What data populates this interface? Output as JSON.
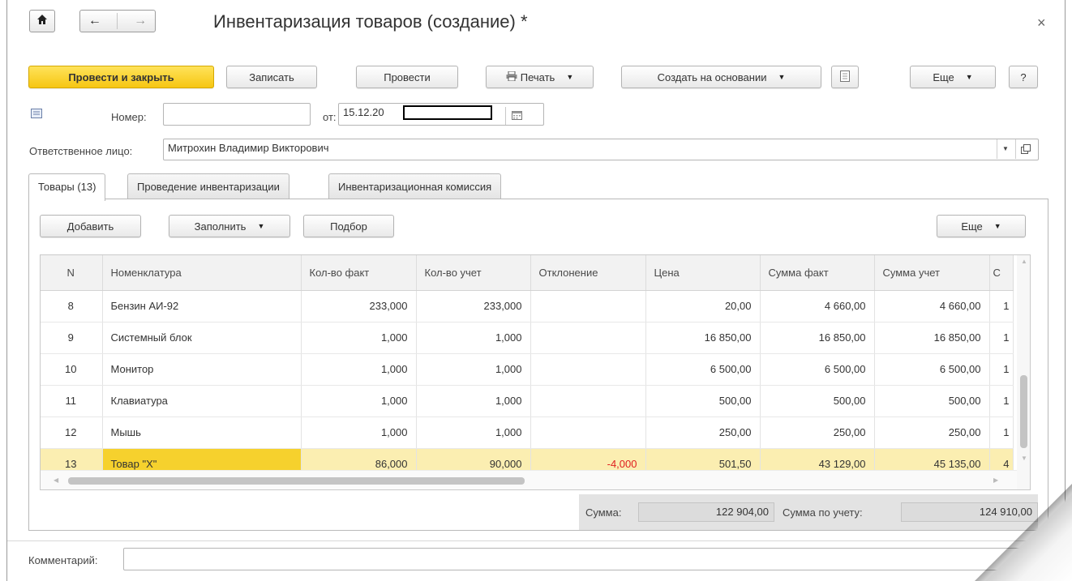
{
  "window": {
    "title": "Инвентаризация товаров (создание) *",
    "close_glyph": "×"
  },
  "nav": {
    "home_icon": "home-icon",
    "back_icon": "arrow-left-icon",
    "forward_icon": "arrow-right-icon"
  },
  "toolbar": {
    "post_close_label": "Провести и закрыть",
    "save_label": "Записать",
    "post_label": "Провести",
    "print_label": "Печать",
    "create_based_label": "Создать на основании",
    "more_label": "Еще",
    "help_label": "?"
  },
  "fields": {
    "number_label": "Номер:",
    "number_value": "",
    "date_label": "от:",
    "date_value": "15.12.20",
    "responsible_label": "Ответственное лицо:",
    "responsible_value": "Митрохин Владимир Викторович",
    "comment_label": "Комментарий:",
    "comment_value": ""
  },
  "tabs": [
    {
      "label": "Товары (13)",
      "active": true
    },
    {
      "label": "Проведение инвентаризации",
      "active": false
    },
    {
      "label": "Инвентаризационная комиссия",
      "active": false
    }
  ],
  "table_toolbar": {
    "add_label": "Добавить",
    "fill_label": "Заполнить",
    "select_label": "Подбор",
    "more_label": "Еще"
  },
  "table": {
    "columns": [
      "N",
      "Номенклатура",
      "Кол-во факт",
      "Кол-во учет",
      "Отклонение",
      "Цена",
      "Сумма факт",
      "Сумма учет",
      "С"
    ],
    "rows": [
      {
        "n": "8",
        "name": "Бензин АИ-92",
        "qty_fact": "233,000",
        "qty_acc": "233,000",
        "dev": "",
        "price": "20,00",
        "sum_fact": "4 660,00",
        "sum_acc": "4 660,00",
        "extra": "1"
      },
      {
        "n": "9",
        "name": "Системный блок",
        "qty_fact": "1,000",
        "qty_acc": "1,000",
        "dev": "",
        "price": "16 850,00",
        "sum_fact": "16 850,00",
        "sum_acc": "16 850,00",
        "extra": "1"
      },
      {
        "n": "10",
        "name": "Монитор",
        "qty_fact": "1,000",
        "qty_acc": "1,000",
        "dev": "",
        "price": "6 500,00",
        "sum_fact": "6 500,00",
        "sum_acc": "6 500,00",
        "extra": "1"
      },
      {
        "n": "11",
        "name": "Клавиатура",
        "qty_fact": "1,000",
        "qty_acc": "1,000",
        "dev": "",
        "price": "500,00",
        "sum_fact": "500,00",
        "sum_acc": "500,00",
        "extra": "1"
      },
      {
        "n": "12",
        "name": "Мышь",
        "qty_fact": "1,000",
        "qty_acc": "1,000",
        "dev": "",
        "price": "250,00",
        "sum_fact": "250,00",
        "sum_acc": "250,00",
        "extra": "1"
      },
      {
        "n": "13",
        "name": "Товар \"Х\"",
        "qty_fact": "86,000",
        "qty_acc": "90,000",
        "dev": "-4,000",
        "price": "501,50",
        "sum_fact": "43 129,00",
        "sum_acc": "45 135,00",
        "extra": "4"
      }
    ],
    "selected_row": "13"
  },
  "totals": {
    "sum_label": "Сумма:",
    "sum_value": "122 904,00",
    "sum_acc_label": "Сумма по учету:",
    "sum_acc_value": "124 910,00"
  },
  "colors": {
    "primary_button": "#f6c612",
    "selected_row": "#fbeeb1",
    "current_cell": "#f6d12d",
    "negative": "#e02020"
  }
}
